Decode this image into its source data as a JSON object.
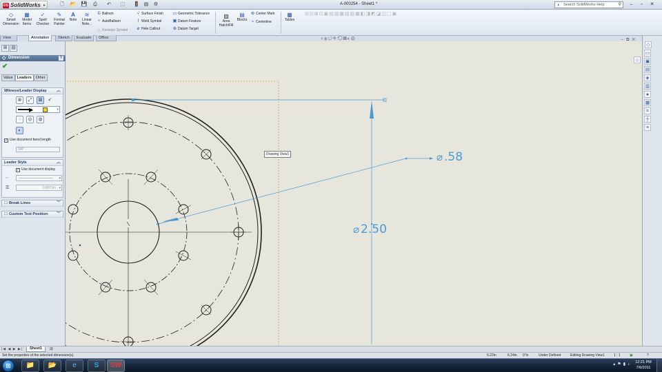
{
  "app": {
    "logo_text": "SolidWorks",
    "document_title": "A-000254 - Sheet1 *",
    "help_search_placeholder": "Search SolidWorks Help"
  },
  "ribbon": {
    "big_buttons": [
      {
        "label": "Smart Dimension",
        "icon": "smart-dimension-icon"
      },
      {
        "label": "Model Items",
        "icon": "model-items-icon"
      },
      {
        "label": "Spell Checker",
        "icon": "spell-checker-icon"
      },
      {
        "label": "Format Painter",
        "icon": "format-painter-icon"
      },
      {
        "label": "Note",
        "icon": "note-icon"
      },
      {
        "label": "Linear Note...",
        "icon": "linear-note-icon"
      }
    ],
    "col1": [
      "Balloon",
      "AutoBalloon",
      "Revision Symbol"
    ],
    "col2": [
      "Surface Finish",
      "Weld Symbol",
      "Hole Callout"
    ],
    "col3": [
      "Geometric Tolerance",
      "Datum Feature",
      "Datum Target"
    ],
    "area_hatch": "Area Hatch/Fill",
    "blocks": "Blocks",
    "col4": [
      "Center Mark",
      "Centerline"
    ],
    "tables": "Tables"
  },
  "tabs": [
    "View Layout",
    "Annotation",
    "Sketch",
    "Evaluate",
    "Office Products"
  ],
  "active_tab": "Annotation",
  "property_manager": {
    "title": "Dimension",
    "help": "?",
    "subtabs": [
      "Value",
      "Leaders",
      "Other"
    ],
    "active_subtab": "Leaders",
    "witness_group": "Witness/Leader Display",
    "use_bend_length": "Use document bend length",
    "bend_length_value": "1/4\"",
    "leader_style_group": "Leader Style",
    "use_doc_display": "Use document display",
    "leader_thickness_value": "0.0071in",
    "break_lines_group": "Break Lines",
    "custom_text_group": "Custom Text Position"
  },
  "drawing": {
    "tooltip": "Drawing View1",
    "dim_small": ".58",
    "dim_large": "2.50",
    "diameter_symbol": "⌀"
  },
  "sheet": {
    "tab_label": "Sheet1"
  },
  "status": {
    "message": "Set the properties of the selected dimension(s).",
    "x": "5.22in",
    "y": "6.24in",
    "z": "0\"in",
    "state": "Under Defined",
    "editing": "Editing Drawing View1",
    "scale": "1 : 1"
  },
  "taskbar": {
    "time": "12:21 PM",
    "date": "7/6/2011"
  },
  "colors": {
    "dimension": "#4a9ad6",
    "canvas": "#e6e6dc",
    "pm_header": "#506a8c"
  }
}
